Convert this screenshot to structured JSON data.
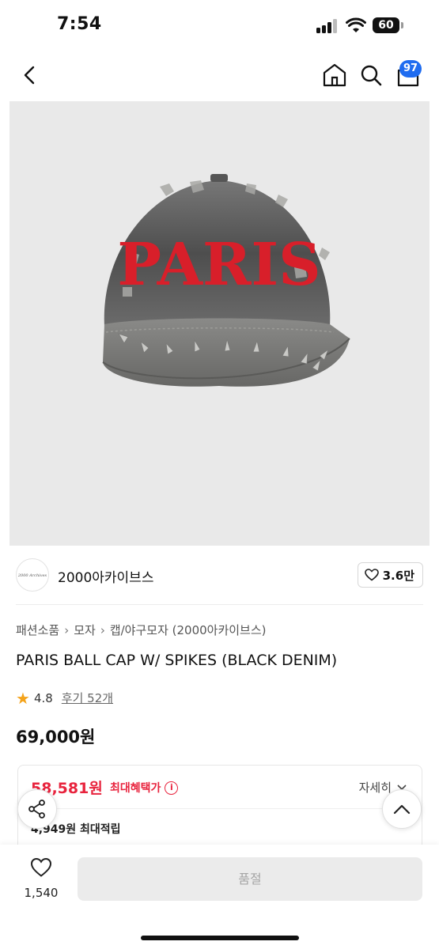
{
  "status_bar": {
    "time": "7:54",
    "battery": "60"
  },
  "nav": {
    "cart_count": "97",
    "icons": [
      "chevron-left-icon",
      "home-icon",
      "search-icon",
      "shopping-bag-icon"
    ]
  },
  "product_image": {
    "cap_text": "PARIS",
    "colors": {
      "denim": "#5f5f5f",
      "embroidery": "#d81f2a",
      "background": "#e9e9e9"
    }
  },
  "brand": {
    "logo_text": "2000 Archives",
    "name": "2000아카이브스",
    "likes": "3.6만"
  },
  "breadcrumb": [
    "패션소품",
    "모자",
    "캡/야구모자 (2000아카이브스)"
  ],
  "product": {
    "title": "PARIS BALL CAP W/ SPIKES (BLACK DENIM)",
    "rating": "4.8",
    "reviews": "후기 52개",
    "price": "69,000원"
  },
  "benefit": {
    "price": "58,581원",
    "label": "최대혜택가",
    "detail_label": "자세히",
    "points": "4,949원 최대적립"
  },
  "bottom_bar": {
    "wish_count": "1,540",
    "button_label": "품절"
  },
  "colors": {
    "accent": "#1f6cf0",
    "sale": "#e8233d",
    "star": "#f4a31a"
  }
}
